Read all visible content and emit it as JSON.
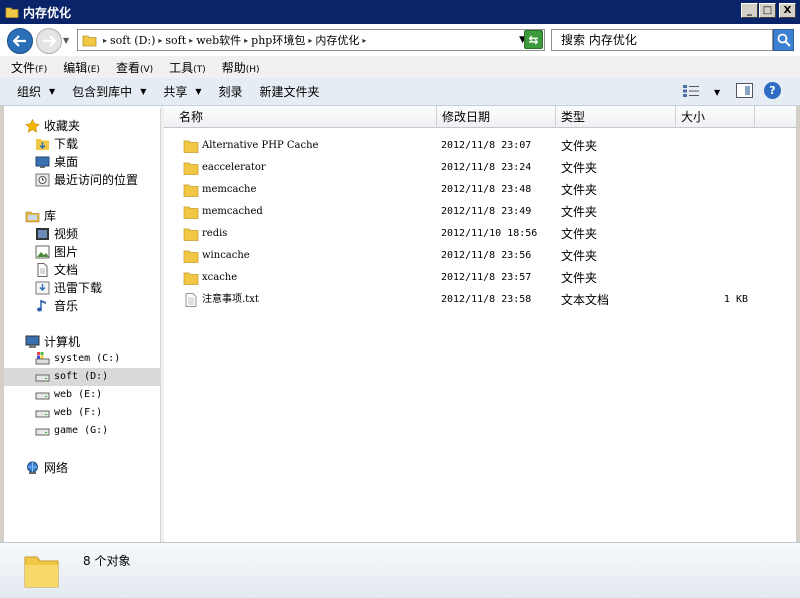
{
  "window": {
    "title": "内存优化",
    "controls": {
      "minimize": "_",
      "maximize": "□",
      "close": "X"
    }
  },
  "address_bar": {
    "crumbs": [
      "soft (D:)",
      "soft",
      "web软件",
      "php环境包",
      "内存优化"
    ],
    "separator": "▸",
    "search_placeholder": "搜索 内存优化"
  },
  "menu": [
    {
      "label": "文件",
      "key": "(F)"
    },
    {
      "label": "编辑",
      "key": "(E)"
    },
    {
      "label": "查看",
      "key": "(V)"
    },
    {
      "label": "工具",
      "key": "(T)"
    },
    {
      "label": "帮助",
      "key": "(H)"
    }
  ],
  "toolbar": {
    "organize": "组织",
    "include_in_library": "包含到库中",
    "share": "共享",
    "burn": "刻录",
    "new_folder": "新建文件夹"
  },
  "nav": {
    "favorites": "收藏夹",
    "downloads": "下载",
    "desktop": "桌面",
    "recent": "最近访问的位置",
    "libraries": "库",
    "videos": "视频",
    "pictures": "图片",
    "documents": "文档",
    "xunlei": "迅雷下载",
    "music": "音乐",
    "computer": "计算机",
    "drives": [
      "system (C:)",
      "soft (D:)",
      "web (E:)",
      "web (F:)",
      "game (G:)"
    ],
    "selected_drive": "soft (D:)",
    "network": "网络"
  },
  "columns": {
    "name": "名称",
    "date": "修改日期",
    "type": "类型",
    "size": "大小"
  },
  "files": [
    {
      "name": "Alternative PHP Cache",
      "date": "2012/11/8 23:07",
      "type": "文件夹",
      "size": "",
      "kind": "folder"
    },
    {
      "name": "eaccelerator",
      "date": "2012/11/8 23:24",
      "type": "文件夹",
      "size": "",
      "kind": "folder"
    },
    {
      "name": "memcache",
      "date": "2012/11/8 23:48",
      "type": "文件夹",
      "size": "",
      "kind": "folder"
    },
    {
      "name": "memcached",
      "date": "2012/11/8 23:49",
      "type": "文件夹",
      "size": "",
      "kind": "folder"
    },
    {
      "name": "redis",
      "date": "2012/11/10 18:56",
      "type": "文件夹",
      "size": "",
      "kind": "folder"
    },
    {
      "name": "wincache",
      "date": "2012/11/8 23:56",
      "type": "文件夹",
      "size": "",
      "kind": "folder"
    },
    {
      "name": "xcache",
      "date": "2012/11/8 23:57",
      "type": "文件夹",
      "size": "",
      "kind": "folder"
    },
    {
      "name": "注意事项.txt",
      "date": "2012/11/8 23:58",
      "type": "文本文档",
      "size": "1 KB",
      "kind": "text"
    }
  ],
  "status": {
    "count_text": "8 个对象"
  },
  "colors": {
    "titlebar": "#0a246a",
    "folder": "#f2c744",
    "selection": "#d9d9d9"
  }
}
